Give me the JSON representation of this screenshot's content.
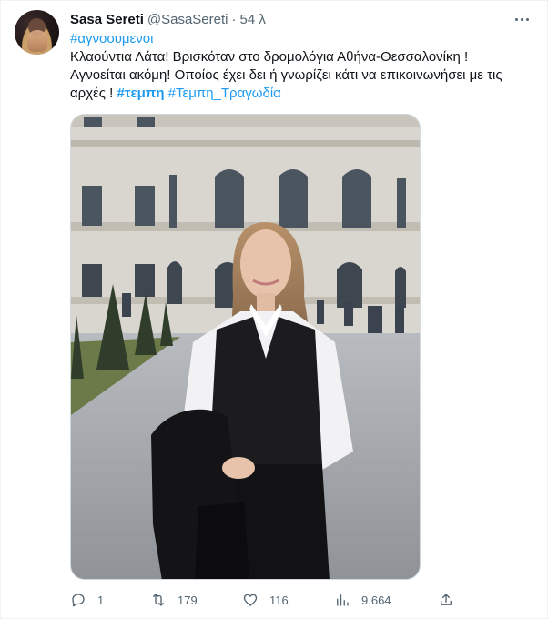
{
  "tweet": {
    "author": {
      "name": "Sasa Sereti",
      "handle": "@SasaSereti",
      "separator": "·",
      "time": "54 λ"
    },
    "text": {
      "hashtag_top": "#αγνοουμενοι",
      "line1": "Κλαούντια Λάτα! Βρισκόταν στο δρομολόγια Αθήνα-Θεσσαλονίκη !",
      "line2": "Αγνοείται ακόμη! Οποίος έχει δει ή γνωρίζει κάτι να επικοινωνήσει με τις",
      "line3_prefix": "αρχές !",
      "hashtag_bold": "#τεμπη",
      "hashtag_last": "#Τεμπη_Τραγωδία"
    },
    "actions": {
      "replies": "1",
      "retweets": "179",
      "likes": "116",
      "views": "9.664"
    },
    "icons": {
      "reply": "reply-icon",
      "retweet": "retweet-icon",
      "like": "heart-icon",
      "views": "views-chart-icon",
      "share": "share-icon",
      "more": "more-dots-icon"
    },
    "colors": {
      "link": "#1d9bf0",
      "secondary": "#536471",
      "primary_text": "#0f1419"
    }
  }
}
